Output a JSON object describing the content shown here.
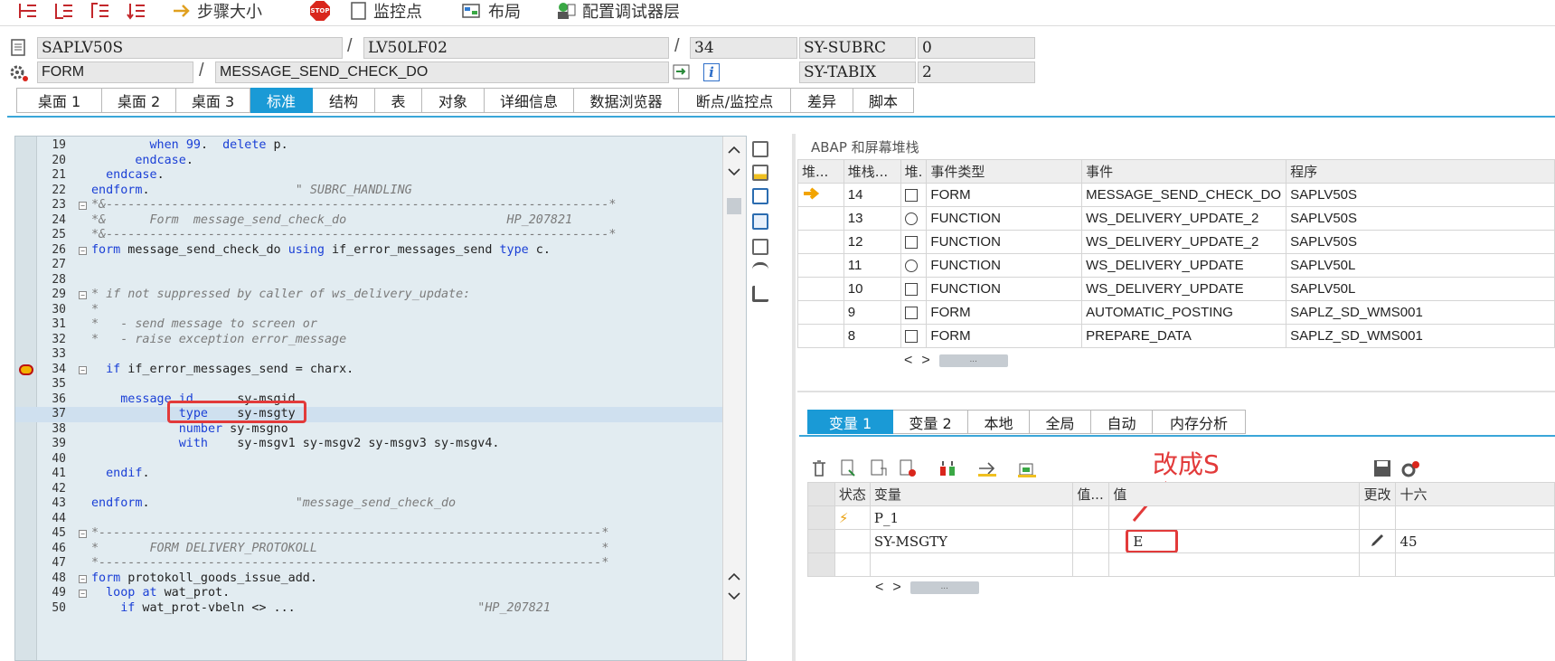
{
  "toolbar": {
    "items": [
      {
        "icon": "step-into-icon",
        "label": ""
      },
      {
        "icon": "step-over-icon",
        "label": ""
      },
      {
        "icon": "return-icon",
        "label": ""
      },
      {
        "icon": "continue-icon",
        "label": ""
      },
      {
        "icon": "step-size-icon",
        "label": "步骤大小"
      },
      {
        "icon": "stop-icon",
        "label": ""
      },
      {
        "icon": "watchpoint-icon",
        "label": "监控点"
      },
      {
        "icon": "layout-icon",
        "label": "布局"
      },
      {
        "icon": "debugger-layer-icon",
        "label": "配置调试器层"
      }
    ],
    "stop_text": "STOP"
  },
  "context": {
    "program": "SAPLV50S",
    "include": "LV50LF02",
    "line": "34",
    "var1_name": "SY-SUBRC",
    "var1_value": "0",
    "event_type": "FORM",
    "event_name": "MESSAGE_SEND_CHECK_DO",
    "var2_name": "SY-TABIX",
    "var2_value": "2",
    "info_glyph": "i"
  },
  "tabs": [
    "桌面 1",
    "桌面 2",
    "桌面 3",
    "标准",
    "结构",
    "表",
    "对象",
    "详细信息",
    "数据浏览器",
    "断点/监控点",
    "差异",
    "脚本"
  ],
  "active_tab": "标准",
  "code": {
    "lines": [
      {
        "n": "19",
        "t": "        when 99.  delete p."
      },
      {
        "n": "20",
        "t": "      endcase."
      },
      {
        "n": "21",
        "t": "  endcase."
      },
      {
        "n": "22",
        "t": "endform.                    \" SUBRC_HANDLING"
      },
      {
        "n": "23",
        "t": "*&---------------------------------------------------------------------*"
      },
      {
        "n": "24",
        "t": "*&      Form  message_send_check_do                      HP_207821"
      },
      {
        "n": "25",
        "t": "*&---------------------------------------------------------------------*"
      },
      {
        "n": "26",
        "t": "form message_send_check_do using if_error_messages_send type c."
      },
      {
        "n": "27",
        "t": ""
      },
      {
        "n": "28",
        "t": ""
      },
      {
        "n": "29",
        "t": "* if not suppressed by caller of ws_delivery_update:"
      },
      {
        "n": "30",
        "t": "*"
      },
      {
        "n": "31",
        "t": "*   - send message to screen or"
      },
      {
        "n": "32",
        "t": "*   - raise exception error_message"
      },
      {
        "n": "33",
        "t": ""
      },
      {
        "n": "34",
        "t": "  if if_error_messages_send = charx."
      },
      {
        "n": "35",
        "t": ""
      },
      {
        "n": "36",
        "t": "    message id      sy-msgid"
      },
      {
        "n": "37",
        "t": "            type    sy-msgty"
      },
      {
        "n": "38",
        "t": "            number sy-msgno"
      },
      {
        "n": "39",
        "t": "            with    sy-msgv1 sy-msgv2 sy-msgv3 sy-msgv4."
      },
      {
        "n": "40",
        "t": ""
      },
      {
        "n": "41",
        "t": "  endif."
      },
      {
        "n": "42",
        "t": ""
      },
      {
        "n": "43",
        "t": "endform.                    \"message_send_check_do"
      },
      {
        "n": "44",
        "t": ""
      },
      {
        "n": "45",
        "t": "*---------------------------------------------------------------------*"
      },
      {
        "n": "46",
        "t": "*       FORM DELIVERY_PROTOKOLL                                       *"
      },
      {
        "n": "47",
        "t": "*---------------------------------------------------------------------*"
      },
      {
        "n": "48",
        "t": "form protokoll_goods_issue_add."
      },
      {
        "n": "49",
        "t": "  loop at wat_prot."
      },
      {
        "n": "50",
        "t": "    if wat_prot-vbeln <> ...                         \"HP_207821"
      }
    ]
  },
  "stack": {
    "title": "ABAP 和屏幕堆栈",
    "headers": [
      "堆...",
      "堆栈...",
      "堆.",
      "事件类型",
      "事件",
      "程序"
    ],
    "rows": [
      {
        "level": "14",
        "type": "FORM",
        "event": "MESSAGE_SEND_CHECK_DO",
        "program": "SAPLV50S",
        "current": true
      },
      {
        "level": "13",
        "type": "FUNCTION",
        "event": "WS_DELIVERY_UPDATE_2",
        "program": "SAPLV50S"
      },
      {
        "level": "12",
        "type": "FUNCTION",
        "event": "WS_DELIVERY_UPDATE_2",
        "program": "SAPLV50S"
      },
      {
        "level": "11",
        "type": "FUNCTION",
        "event": "WS_DELIVERY_UPDATE",
        "program": "SAPLV50L"
      },
      {
        "level": "10",
        "type": "FUNCTION",
        "event": "WS_DELIVERY_UPDATE",
        "program": "SAPLV50L"
      },
      {
        "level": "9",
        "type": "FORM",
        "event": "AUTOMATIC_POSTING",
        "program": "SAPLZ_SD_WMS001"
      },
      {
        "level": "8",
        "type": "FORM",
        "event": "PREPARE_DATA",
        "program": "SAPLZ_SD_WMS001"
      }
    ]
  },
  "var_tabs": [
    "变量 1",
    "变量 2",
    "本地",
    "全局",
    "自动",
    "内存分析"
  ],
  "var_active_tab": "变量 1",
  "var_table": {
    "headers": [
      "状态",
      "变量",
      "值...",
      "值",
      "更改",
      "十六"
    ],
    "rows": [
      {
        "status": "⚡",
        "name": "P_1",
        "value": ""
      },
      {
        "status": "",
        "name": "SY-MSGTY",
        "value": "E",
        "hex": "45"
      }
    ]
  },
  "annotation": "改成S",
  "scroll_thumb": "..."
}
